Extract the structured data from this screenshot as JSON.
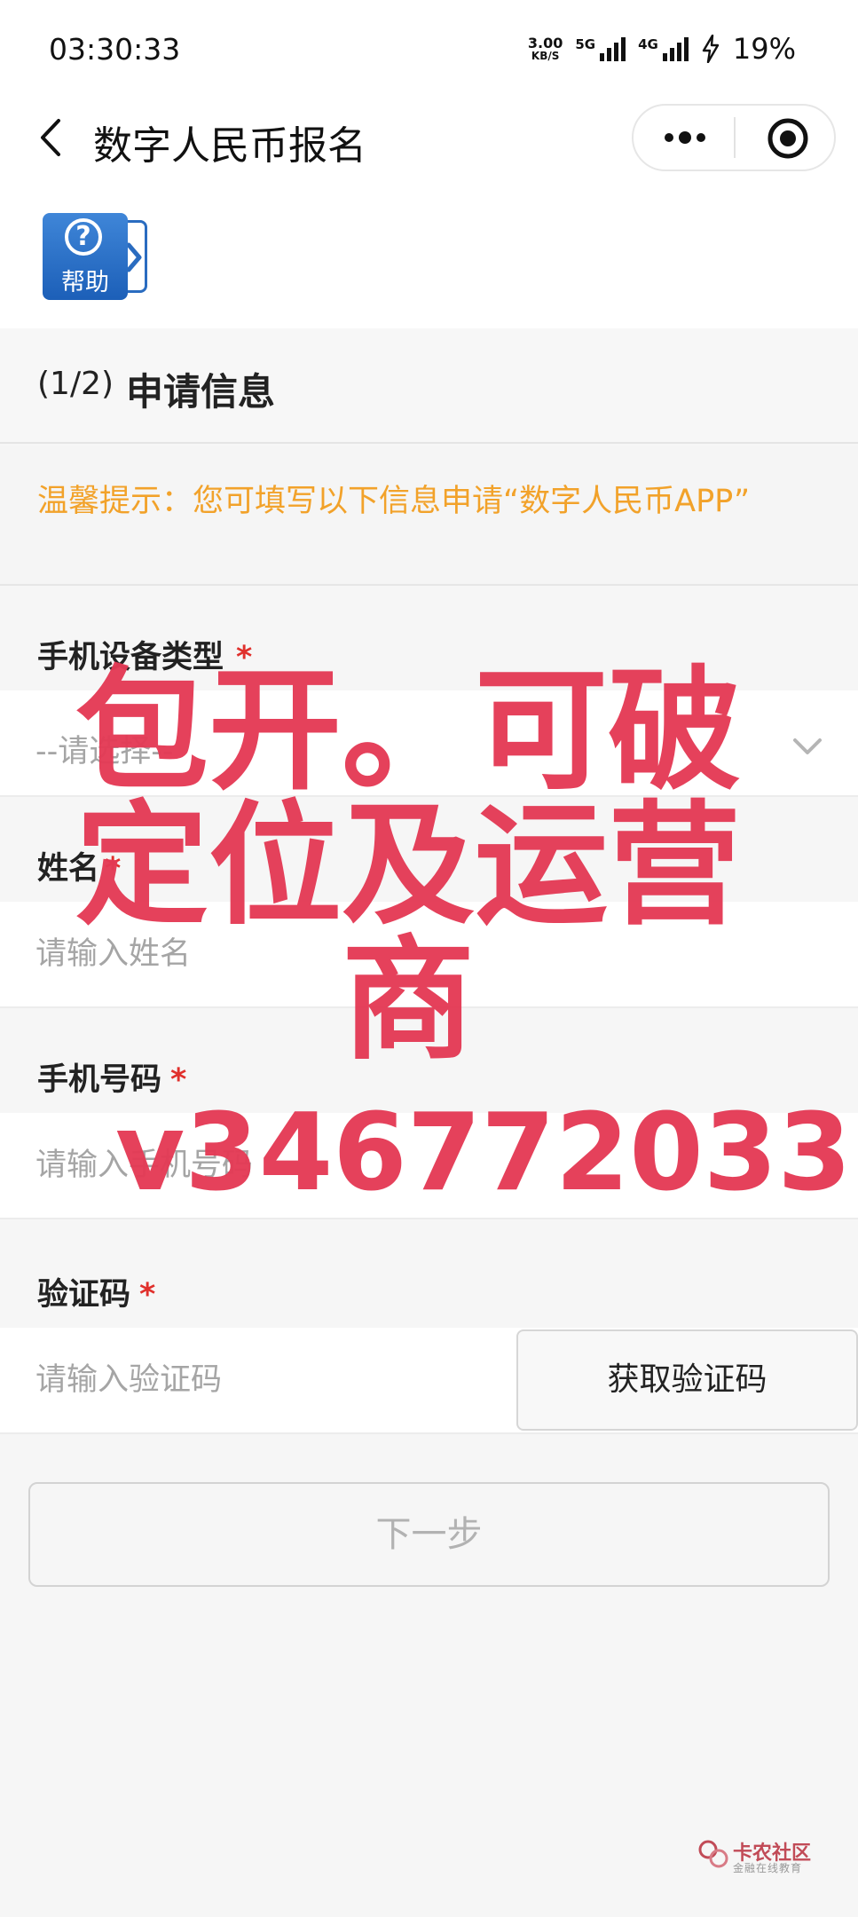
{
  "status_bar": {
    "time": "03:30:33",
    "net_speed_value": "3.00",
    "net_speed_unit": "KB/S",
    "sim1_label": "5G",
    "sim2_label": "4G",
    "battery_percent": "19%"
  },
  "nav": {
    "title": "数字人民币报名"
  },
  "help": {
    "label": "帮助",
    "symbol": "?"
  },
  "section": {
    "step": "(1/2)",
    "title": "申请信息"
  },
  "tip": {
    "text": "温馨提示：您可填写以下信息申请“数字人民币APP”"
  },
  "form": {
    "device": {
      "label": "手机设备类型",
      "required": "*",
      "placeholder": "--请选择--"
    },
    "name": {
      "label": "姓名",
      "required": "*",
      "placeholder": "请输入姓名"
    },
    "phone": {
      "label": "手机号码",
      "required": "*",
      "placeholder": "请输入手机号码"
    },
    "code": {
      "label": "验证码",
      "required": "*",
      "placeholder": "请输入验证码",
      "button": "获取验证码"
    }
  },
  "next_button": "下一步",
  "overlay": {
    "line1": "包开。可破",
    "line2": "定位及运营",
    "line3": "商",
    "line4": "v346772033"
  },
  "watermark": {
    "title": "卡农社区",
    "subtitle": "金融在线教育"
  },
  "colors": {
    "tip": "#f2a22a",
    "required": "#e0302c",
    "overlay": "#e43a55",
    "help_blue": "#1c5fb8"
  }
}
